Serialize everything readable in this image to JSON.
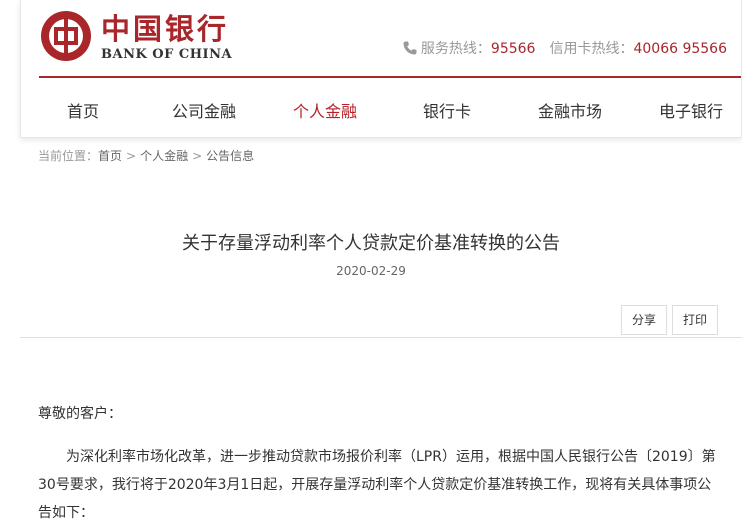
{
  "logo": {
    "chinese": "中国银行",
    "english": "BANK OF CHINA"
  },
  "hotlines": {
    "service_label": "服务热线：",
    "service_number": "95566",
    "card_label": "信用卡热线：",
    "card_number": "40066 95566"
  },
  "nav": {
    "items": [
      {
        "label": "首页"
      },
      {
        "label": "公司金融"
      },
      {
        "label": "个人金融"
      },
      {
        "label": "银行卡"
      },
      {
        "label": "金融市场"
      },
      {
        "label": "电子银行"
      }
    ],
    "active_color": "#b8212a"
  },
  "breadcrumb": {
    "prefix": "当前位置：",
    "items": [
      "首页",
      "个人金融",
      "公告信息"
    ]
  },
  "article": {
    "title": "关于存量浮动利率个人贷款定价基准转换的公告",
    "date": "2020-02-29",
    "share_label": "分享",
    "print_label": "打印",
    "greeting": "尊敬的客户：",
    "paragraph": "为深化利率市场化改革，进一步推动贷款市场报价利率（LPR）运用，根据中国人民银行公告〔2019〕第30号要求，我行将于2020年3月1日起，开展存量浮动利率个人贷款定价基准转换工作，现将有关具体事项公告如下："
  },
  "colors": {
    "brand_red": "#a9262b",
    "text": "#333333",
    "muted": "#999999"
  },
  "icons": {
    "phone": "phone-icon",
    "logo": "boc-logo-icon"
  }
}
